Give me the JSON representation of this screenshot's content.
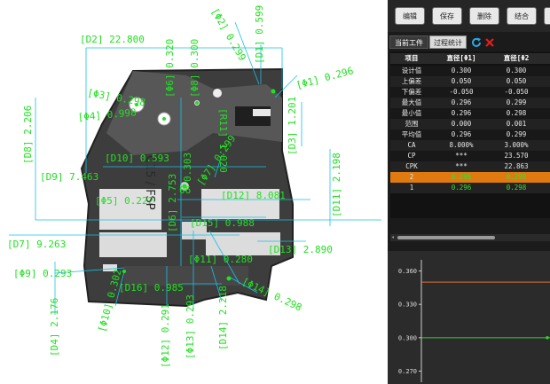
{
  "cad": {
    "labels": {
      "phi1": "[Φ1] 0.296",
      "phi2": "[Φ2] 0.299",
      "phi3": "[Φ3] 0.298",
      "phi4": "[Φ4] 0.998",
      "phi5": "[Φ5] 0.222",
      "phi6": "[Φ6] 0.320",
      "phi7": "[Φ7] 0.299",
      "phi8": "[Φ8] 0.300",
      "phi9": "[Φ9] 0.293",
      "phi10": "[Φ10] 0.302",
      "phi11": "[Φ11] 0.280",
      "phi12": "[Φ12] 0.291",
      "phi13": "[Φ13] 0.293",
      "phi14": "[Φ14] 0.298",
      "d1": "[D1] 0.599",
      "d2": "[D2] 22.800",
      "d3": "[D3] 1.201",
      "d4": "[D4] 2.176",
      "d6": "[D6] 2.753",
      "d7": "[D7] 9.263",
      "d8": "[D8] 2.206",
      "d9": "[D9] 7.463",
      "d10": "[D10] 0.593",
      "d11": "[D11] 2.198",
      "d12": "[D12] 8.081",
      "d13": "[D13] 2.890",
      "d14": "[D14] 2.218",
      "d15": "[D15] 0.988",
      "d16": "[D16] 0.985",
      "r11": "[R11] 1.020",
      "r_mid": "0.303",
      "tag06": "06"
    },
    "part_marking": "C15 / FSP"
  },
  "toolbar": {
    "buttons": [
      "编辑",
      "保存",
      "删除",
      "结合"
    ]
  },
  "tabs": {
    "current": "当前工件",
    "process": "过程统计"
  },
  "table": {
    "headers": [
      "项目",
      "直径[Φ1]",
      "直径[Φ2"
    ],
    "rows": [
      {
        "label": "设计值",
        "c1": "0.300",
        "c2": "0.300"
      },
      {
        "label": "上偏差",
        "c1": "0.050",
        "c2": "0.050"
      },
      {
        "label": "下偏差",
        "c1": "-0.050",
        "c2": "-0.050"
      },
      {
        "label": "最大值",
        "c1": "0.296",
        "c2": "0.299"
      },
      {
        "label": "最小值",
        "c1": "0.296",
        "c2": "0.298"
      },
      {
        "label": "范围",
        "c1": "0.000",
        "c2": "0.001"
      },
      {
        "label": "平均值",
        "c1": "0.296",
        "c2": "0.299"
      },
      {
        "label": "CA",
        "c1": "8.000%",
        "c2": "3.000%"
      },
      {
        "label": "CP",
        "c1": "***",
        "c2": "23.570"
      },
      {
        "label": "CPK",
        "c1": "***",
        "c2": "22.863"
      },
      {
        "label": "2",
        "c1": "0.296",
        "c2": "0.299"
      },
      {
        "label": "1",
        "c1": "0.296",
        "c2": "0.298"
      }
    ]
  },
  "chart_data": {
    "type": "line",
    "title": "",
    "xlabel": "",
    "ylabel": "",
    "ylim": [
      0.26,
      0.37
    ],
    "yticks": [
      "0.360",
      "0.330",
      "0.300",
      "0.270"
    ],
    "ytick_values": [
      0.36,
      0.33,
      0.3,
      0.27
    ],
    "series": [
      {
        "values": [
          0.35,
          0.35
        ],
        "color": "#e0703a"
      },
      {
        "values": [
          0.3,
          0.3
        ],
        "color": "#33cc33"
      }
    ],
    "points": [
      {
        "x": 1,
        "y": 0.3
      }
    ]
  },
  "colors": {
    "annotation": "#22e022",
    "upper_limit": "#e0703a",
    "mean_line": "#33cc33",
    "highlight_row": "#e07a10"
  }
}
